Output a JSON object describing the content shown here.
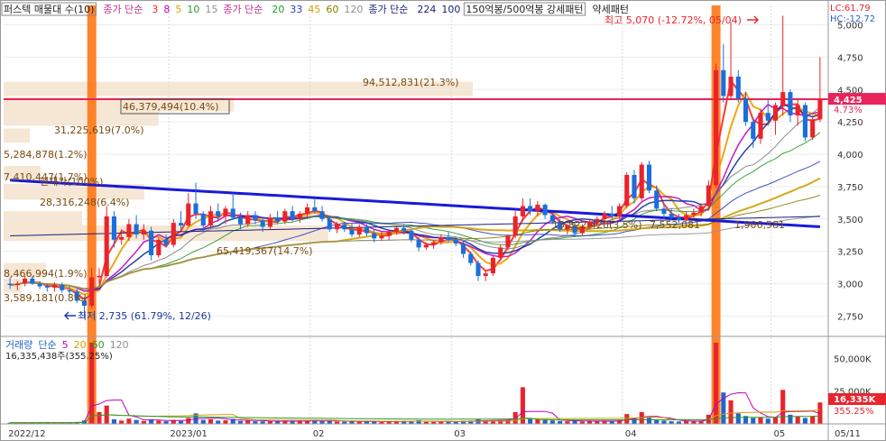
{
  "legend": {
    "main": [
      {
        "text": "퍼스텍 매물대 수(10)",
        "color": "#222222",
        "boxed": true
      },
      {
        "text": "종가 단순",
        "color": "#c0338c"
      },
      {
        "text": "3",
        "color": "#ff2222"
      },
      {
        "text": "8",
        "color": "#c000c0"
      },
      {
        "text": "5",
        "color": "#e8a000"
      },
      {
        "text": "10",
        "color": "#2a9a2a"
      },
      {
        "text": "15",
        "color": "#909090"
      },
      {
        "text": "종가 단순",
        "color": "#c0338c"
      },
      {
        "text": "20",
        "color": "#2a9a2a"
      },
      {
        "text": "33",
        "color": "#3040c0"
      },
      {
        "text": "45",
        "color": "#d0a000"
      },
      {
        "text": "60",
        "color": "#808000"
      },
      {
        "text": "120",
        "color": "#909090"
      },
      {
        "text": "종가 단순",
        "color": "#1a237e"
      },
      {
        "text": "224",
        "color": "#1a237e"
      },
      {
        "text": "100",
        "color": "#1a237e"
      },
      {
        "text": "150억봉/500억봉 강세패턴",
        "color": "#222222",
        "boxed": true
      },
      {
        "text": "약세패턴",
        "color": "#222222"
      }
    ],
    "volume": [
      {
        "text": "거래량",
        "color": "#2266cc"
      },
      {
        "text": "단순",
        "color": "#2266cc"
      },
      {
        "text": "5",
        "color": "#c000c0"
      },
      {
        "text": "20",
        "color": "#d0a000"
      },
      {
        "text": "60",
        "color": "#2a9a2a"
      },
      {
        "text": "120",
        "color": "#909090"
      }
    ]
  },
  "header_right": {
    "lc": "LC:61.79",
    "hc": "HC:-12.72"
  },
  "price_axis": {
    "ticks": [
      "5,000",
      "4,750",
      "4,500",
      "4,250",
      "4,000",
      "3,750",
      "3,500",
      "3,250",
      "3,000",
      "2,750"
    ]
  },
  "price_badges": {
    "current": "4,425",
    "pct": "4.73%"
  },
  "volume_axis": {
    "ticks": [
      "50,000K",
      "25,000K"
    ],
    "badge_value": "16,335K",
    "badge_pct": "355.25%"
  },
  "date_axis": [
    "2022/12",
    "2023/01",
    "02",
    "03",
    "04",
    "05",
    "05/11"
  ],
  "annotations": {
    "high": "최고 5,070 (-12.72%, 05/04)",
    "low": "최저 2,735 (61.79%, 12/26)",
    "volume_value": "16,335,438주(355.25%)"
  },
  "volume_profile_labels": [
    "94,512,831(21.3%)",
    "46,379,494(10.4%)",
    "31,225,619(7.0%)",
    "5,284,878(1.2%)",
    "7,410,447(1.7%)",
    "28,316,248(6.4%)",
    "65,419,367(14.7%)",
    "8,466,994(1.9%)",
    "3,589,181(0.8%)",
    "현재가(100%)",
    "15,822,420(3.5%)",
    "7,552,081",
    "1,906,581"
  ],
  "chart_data": {
    "type": "candlestick",
    "price_range": [
      2600,
      5150
    ],
    "volume_range_k": [
      0,
      62000
    ],
    "highlighted_sessions": [
      "12/27",
      "04/26"
    ],
    "current_price": 4425,
    "high": {
      "value": 5070,
      "date": "05/04"
    },
    "low": {
      "value": 2735,
      "date": "12/26"
    },
    "candles": [
      {
        "o": 3000,
        "h": 3050,
        "l": 2960,
        "c": 2990
      },
      {
        "o": 2990,
        "h": 3020,
        "l": 2950,
        "c": 3000
      },
      {
        "o": 3000,
        "h": 3060,
        "l": 2980,
        "c": 3040
      },
      {
        "o": 3040,
        "h": 3060,
        "l": 2990,
        "c": 3000
      },
      {
        "o": 3000,
        "h": 3020,
        "l": 2960,
        "c": 2980
      },
      {
        "o": 2980,
        "h": 3000,
        "l": 2940,
        "c": 2970
      },
      {
        "o": 2970,
        "h": 3010,
        "l": 2940,
        "c": 2990
      },
      {
        "o": 2990,
        "h": 3010,
        "l": 2930,
        "c": 2950
      },
      {
        "o": 2950,
        "h": 2980,
        "l": 2910,
        "c": 2940
      },
      {
        "o": 2940,
        "h": 2960,
        "l": 2850,
        "c": 2870
      },
      {
        "o": 2870,
        "h": 2900,
        "l": 2735,
        "c": 2830
      },
      {
        "o": 2830,
        "h": 3120,
        "l": 2810,
        "c": 3050
      },
      {
        "o": 3050,
        "h": 3120,
        "l": 3000,
        "c": 3060
      },
      {
        "o": 3060,
        "h": 3600,
        "l": 3050,
        "c": 3520
      },
      {
        "o": 3520,
        "h": 3560,
        "l": 3280,
        "c": 3340
      },
      {
        "o": 3340,
        "h": 3420,
        "l": 3300,
        "c": 3360
      },
      {
        "o": 3360,
        "h": 3500,
        "l": 3330,
        "c": 3460
      },
      {
        "o": 3460,
        "h": 3530,
        "l": 3350,
        "c": 3380
      },
      {
        "o": 3380,
        "h": 3460,
        "l": 3340,
        "c": 3410
      },
      {
        "o": 3410,
        "h": 3440,
        "l": 3180,
        "c": 3220
      },
      {
        "o": 3220,
        "h": 3360,
        "l": 3200,
        "c": 3340
      },
      {
        "o": 3340,
        "h": 3380,
        "l": 3280,
        "c": 3300
      },
      {
        "o": 3300,
        "h": 3500,
        "l": 3280,
        "c": 3470
      },
      {
        "o": 3470,
        "h": 3560,
        "l": 3420,
        "c": 3450
      },
      {
        "o": 3450,
        "h": 3700,
        "l": 3440,
        "c": 3620
      },
      {
        "o": 3620,
        "h": 3780,
        "l": 3500,
        "c": 3540
      },
      {
        "o": 3540,
        "h": 3560,
        "l": 3400,
        "c": 3450
      },
      {
        "o": 3450,
        "h": 3600,
        "l": 3420,
        "c": 3560
      },
      {
        "o": 3560,
        "h": 3620,
        "l": 3480,
        "c": 3520
      },
      {
        "o": 3520,
        "h": 3600,
        "l": 3460,
        "c": 3580
      },
      {
        "o": 3580,
        "h": 3700,
        "l": 3500,
        "c": 3510
      },
      {
        "o": 3510,
        "h": 3550,
        "l": 3420,
        "c": 3460
      },
      {
        "o": 3460,
        "h": 3560,
        "l": 3440,
        "c": 3530
      },
      {
        "o": 3530,
        "h": 3560,
        "l": 3460,
        "c": 3490
      },
      {
        "o": 3490,
        "h": 3500,
        "l": 3400,
        "c": 3440
      },
      {
        "o": 3440,
        "h": 3540,
        "l": 3420,
        "c": 3510
      },
      {
        "o": 3510,
        "h": 3560,
        "l": 3460,
        "c": 3480
      },
      {
        "o": 3480,
        "h": 3580,
        "l": 3460,
        "c": 3560
      },
      {
        "o": 3560,
        "h": 3600,
        "l": 3480,
        "c": 3500
      },
      {
        "o": 3500,
        "h": 3560,
        "l": 3470,
        "c": 3540
      },
      {
        "o": 3540,
        "h": 3620,
        "l": 3500,
        "c": 3590
      },
      {
        "o": 3590,
        "h": 3660,
        "l": 3540,
        "c": 3560
      },
      {
        "o": 3560,
        "h": 3600,
        "l": 3480,
        "c": 3500
      },
      {
        "o": 3500,
        "h": 3520,
        "l": 3400,
        "c": 3420
      },
      {
        "o": 3420,
        "h": 3480,
        "l": 3390,
        "c": 3460
      },
      {
        "o": 3460,
        "h": 3480,
        "l": 3400,
        "c": 3420
      },
      {
        "o": 3420,
        "h": 3470,
        "l": 3360,
        "c": 3380
      },
      {
        "o": 3380,
        "h": 3460,
        "l": 3360,
        "c": 3440
      },
      {
        "o": 3440,
        "h": 3460,
        "l": 3370,
        "c": 3390
      },
      {
        "o": 3390,
        "h": 3420,
        "l": 3320,
        "c": 3350
      },
      {
        "o": 3350,
        "h": 3400,
        "l": 3330,
        "c": 3370
      },
      {
        "o": 3370,
        "h": 3420,
        "l": 3340,
        "c": 3400
      },
      {
        "o": 3400,
        "h": 3450,
        "l": 3380,
        "c": 3430
      },
      {
        "o": 3430,
        "h": 3460,
        "l": 3380,
        "c": 3410
      },
      {
        "o": 3410,
        "h": 3420,
        "l": 3320,
        "c": 3340
      },
      {
        "o": 3340,
        "h": 3360,
        "l": 3250,
        "c": 3280
      },
      {
        "o": 3280,
        "h": 3320,
        "l": 3260,
        "c": 3300
      },
      {
        "o": 3300,
        "h": 3340,
        "l": 3270,
        "c": 3320
      },
      {
        "o": 3320,
        "h": 3380,
        "l": 3300,
        "c": 3360
      },
      {
        "o": 3360,
        "h": 3400,
        "l": 3320,
        "c": 3340
      },
      {
        "o": 3340,
        "h": 3360,
        "l": 3290,
        "c": 3310
      },
      {
        "o": 3310,
        "h": 3330,
        "l": 3200,
        "c": 3230
      },
      {
        "o": 3230,
        "h": 3250,
        "l": 3140,
        "c": 3160
      },
      {
        "o": 3160,
        "h": 3180,
        "l": 3020,
        "c": 3060
      },
      {
        "o": 3060,
        "h": 3100,
        "l": 3020,
        "c": 3080
      },
      {
        "o": 3080,
        "h": 3220,
        "l": 3060,
        "c": 3200
      },
      {
        "o": 3200,
        "h": 3300,
        "l": 3180,
        "c": 3280
      },
      {
        "o": 3280,
        "h": 3380,
        "l": 3260,
        "c": 3370
      },
      {
        "o": 3370,
        "h": 3560,
        "l": 3350,
        "c": 3520
      },
      {
        "o": 3520,
        "h": 3660,
        "l": 3480,
        "c": 3600
      },
      {
        "o": 3600,
        "h": 3660,
        "l": 3530,
        "c": 3560
      },
      {
        "o": 3560,
        "h": 3640,
        "l": 3520,
        "c": 3610
      },
      {
        "o": 3610,
        "h": 3620,
        "l": 3500,
        "c": 3530
      },
      {
        "o": 3530,
        "h": 3550,
        "l": 3460,
        "c": 3480
      },
      {
        "o": 3480,
        "h": 3500,
        "l": 3400,
        "c": 3420
      },
      {
        "o": 3420,
        "h": 3460,
        "l": 3380,
        "c": 3450
      },
      {
        "o": 3450,
        "h": 3470,
        "l": 3360,
        "c": 3390
      },
      {
        "o": 3390,
        "h": 3460,
        "l": 3370,
        "c": 3440
      },
      {
        "o": 3440,
        "h": 3500,
        "l": 3420,
        "c": 3480
      },
      {
        "o": 3480,
        "h": 3520,
        "l": 3440,
        "c": 3500
      },
      {
        "o": 3500,
        "h": 3560,
        "l": 3470,
        "c": 3540
      },
      {
        "o": 3540,
        "h": 3600,
        "l": 3500,
        "c": 3520
      },
      {
        "o": 3520,
        "h": 3620,
        "l": 3500,
        "c": 3600
      },
      {
        "o": 3600,
        "h": 3860,
        "l": 3580,
        "c": 3840
      },
      {
        "o": 3840,
        "h": 3880,
        "l": 3620,
        "c": 3660
      },
      {
        "o": 3660,
        "h": 3940,
        "l": 3640,
        "c": 3920
      },
      {
        "o": 3920,
        "h": 3950,
        "l": 3700,
        "c": 3720
      },
      {
        "o": 3720,
        "h": 3760,
        "l": 3560,
        "c": 3580
      },
      {
        "o": 3580,
        "h": 3620,
        "l": 3500,
        "c": 3540
      },
      {
        "o": 3540,
        "h": 3580,
        "l": 3490,
        "c": 3510
      },
      {
        "o": 3510,
        "h": 3540,
        "l": 3470,
        "c": 3490
      },
      {
        "o": 3490,
        "h": 3560,
        "l": 3480,
        "c": 3530
      },
      {
        "o": 3530,
        "h": 3580,
        "l": 3500,
        "c": 3550
      },
      {
        "o": 3550,
        "h": 3620,
        "l": 3520,
        "c": 3600
      },
      {
        "o": 3600,
        "h": 3800,
        "l": 3580,
        "c": 3760
      },
      {
        "o": 3760,
        "h": 4700,
        "l": 3740,
        "c": 4650
      },
      {
        "o": 4650,
        "h": 4850,
        "l": 4400,
        "c": 4450
      },
      {
        "o": 4450,
        "h": 5020,
        "l": 4420,
        "c": 4600
      },
      {
        "o": 4600,
        "h": 4650,
        "l": 4400,
        "c": 4430
      },
      {
        "o": 4430,
        "h": 4480,
        "l": 4220,
        "c": 4250
      },
      {
        "o": 4250,
        "h": 4280,
        "l": 4050,
        "c": 4120
      },
      {
        "o": 4120,
        "h": 4350,
        "l": 4080,
        "c": 4320
      },
      {
        "o": 4320,
        "h": 4420,
        "l": 4220,
        "c": 4260
      },
      {
        "o": 4260,
        "h": 4400,
        "l": 4150,
        "c": 4380
      },
      {
        "o": 4380,
        "h": 5070,
        "l": 4300,
        "c": 4480
      },
      {
        "o": 4480,
        "h": 4500,
        "l": 4250,
        "c": 4300
      },
      {
        "o": 4300,
        "h": 4420,
        "l": 4220,
        "c": 4380
      },
      {
        "o": 4380,
        "h": 4400,
        "l": 4100,
        "c": 4130
      },
      {
        "o": 4130,
        "h": 4300,
        "l": 4110,
        "c": 4270
      },
      {
        "o": 4270,
        "h": 4750,
        "l": 4250,
        "c": 4425
      }
    ],
    "volume_k": [
      900,
      700,
      1100,
      800,
      900,
      1200,
      700,
      900,
      1000,
      1500,
      2600,
      62000,
      9000,
      14000,
      3500,
      2500,
      4000,
      3000,
      2200,
      3500,
      2500,
      2000,
      3000,
      2200,
      4500,
      8000,
      3000,
      3500,
      2500,
      2800,
      3800,
      2200,
      2500,
      2000,
      1900,
      2200,
      1800,
      2500,
      2100,
      1900,
      2400,
      3000,
      2000,
      2500,
      1800,
      1700,
      2200,
      1600,
      2000,
      1700,
      1500,
      1900,
      2200,
      1800,
      2100,
      2800,
      1600,
      1500,
      1900,
      1700,
      1600,
      2400,
      2500,
      3500,
      2000,
      2500,
      3000,
      3200,
      9000,
      28000,
      4000,
      3500,
      3000,
      2600,
      2200,
      2000,
      2400,
      1800,
      2200,
      2000,
      2400,
      2100,
      2600,
      7500,
      4500,
      9000,
      5000,
      3000,
      2500,
      2000,
      1800,
      2200,
      2000,
      2400,
      7000,
      62000,
      24000,
      18000,
      8000,
      6000,
      4500,
      5000,
      4000,
      5000,
      26000,
      7000,
      5500,
      4500,
      6000,
      16335
    ],
    "volume_profile": [
      {
        "price_low": 4450,
        "price_high": 4560,
        "volume": 94512831,
        "pct": 21.3
      },
      {
        "price_low": 4330,
        "price_high": 4440,
        "volume": 46379494,
        "pct": 10.4
      },
      {
        "price_low": 4220,
        "price_high": 4330,
        "volume": 31225619,
        "pct": 7.0
      },
      {
        "price_low": 4090,
        "price_high": 4200,
        "volume": 5284878,
        "pct": 1.2
      },
      {
        "price_low": 3800,
        "price_high": 3910,
        "volume": 7410447,
        "pct": 1.7
      },
      {
        "price_low": 3650,
        "price_high": 3770,
        "volume": 28316248,
        "pct": 6.4
      },
      {
        "price_low": 3450,
        "price_high": 3560,
        "volume": 15822420,
        "pct": 3.5
      },
      {
        "price_low": 3330,
        "price_high": 3450,
        "volume": 65419367,
        "pct": 14.7
      },
      {
        "price_low": 3050,
        "price_high": 3160,
        "volume": 8466994,
        "pct": 1.9
      },
      {
        "price_low": 2930,
        "price_high": 3040,
        "volume": 3589181,
        "pct": 0.8
      }
    ],
    "moving_average_periods": [
      3,
      8,
      5,
      10,
      15,
      20,
      33,
      45,
      60,
      120,
      224,
      100
    ]
  }
}
